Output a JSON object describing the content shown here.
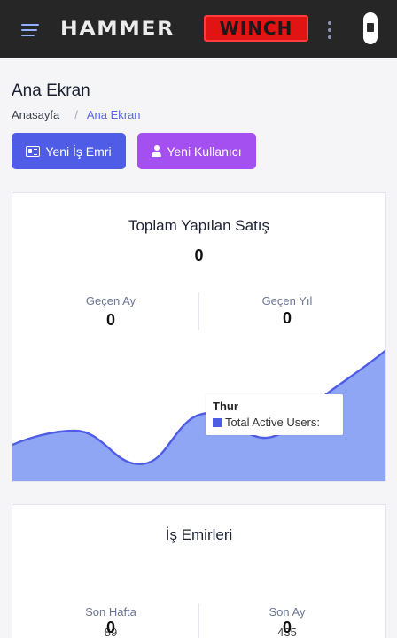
{
  "header": {
    "logo_part1": "HAMMER",
    "logo_part2": "WINCH",
    "menu_icon": "hamburger-menu-icon",
    "more_icon": "kebab-menu-icon",
    "colors": {
      "bar": "#262626",
      "winch_red": "#e11414"
    }
  },
  "page": {
    "title": "Ana Ekran",
    "breadcrumb": [
      "Anasayfa",
      "/",
      "Ana Ekran"
    ]
  },
  "actions": {
    "new_work_order": "Yeni İş Emri",
    "new_user": "Yeni Kullanıcı",
    "colors": {
      "primary": "#4e5ce6",
      "purple": "#a44ff0"
    }
  },
  "sales_card": {
    "title": "Toplam Yapılan Satış",
    "total": "0",
    "last_month_label": "Geçen Ay",
    "last_month_value": "0",
    "last_year_label": "Geçen Yıl",
    "last_year_value": "0",
    "tooltip_title": "Thur",
    "tooltip_series": "Total Active Users:",
    "chart_colors": {
      "fill": "#8ea6f4",
      "line": "#4e5ce6"
    }
  },
  "orders_card": {
    "title": "İş Emirleri",
    "last_week_label": "Son Hafta",
    "last_week_value": "0",
    "last_week_sub": "89",
    "last_month_label": "Son Ay",
    "last_month_value": "0",
    "last_month_sub": "435"
  }
}
